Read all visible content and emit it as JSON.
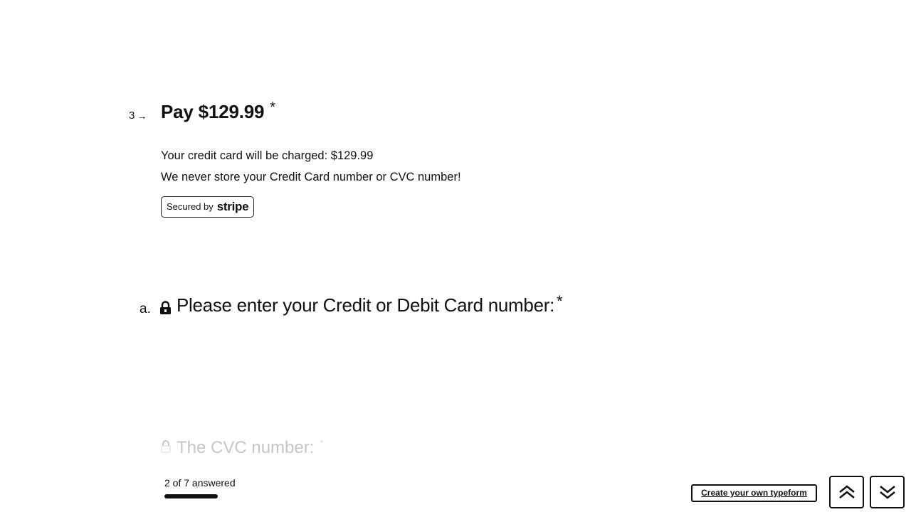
{
  "question3": {
    "number": "3",
    "title": "Pay $129.99",
    "required_mark": "*",
    "description_lines": [
      "Your credit card will be charged: $129.99",
      "We never store your Credit Card number or CVC number!"
    ],
    "badge": {
      "prefix": "Secured by",
      "brand": "stripe"
    }
  },
  "subquestion_a": {
    "letter": "a.",
    "icon": "lock-icon",
    "title": "Please enter your Credit or Debit Card number:",
    "required_mark": "*"
  },
  "next_question": {
    "icon": "lock-icon",
    "title": "The CVC number:",
    "required_mark": "*"
  },
  "progress": {
    "label": "2 of 7 answered",
    "answered": 2,
    "total": 7
  },
  "footer": {
    "create_label": "Create your own typeform",
    "nav_up_icon": "chevron-up-icon",
    "nav_down_icon": "chevron-down-icon"
  }
}
